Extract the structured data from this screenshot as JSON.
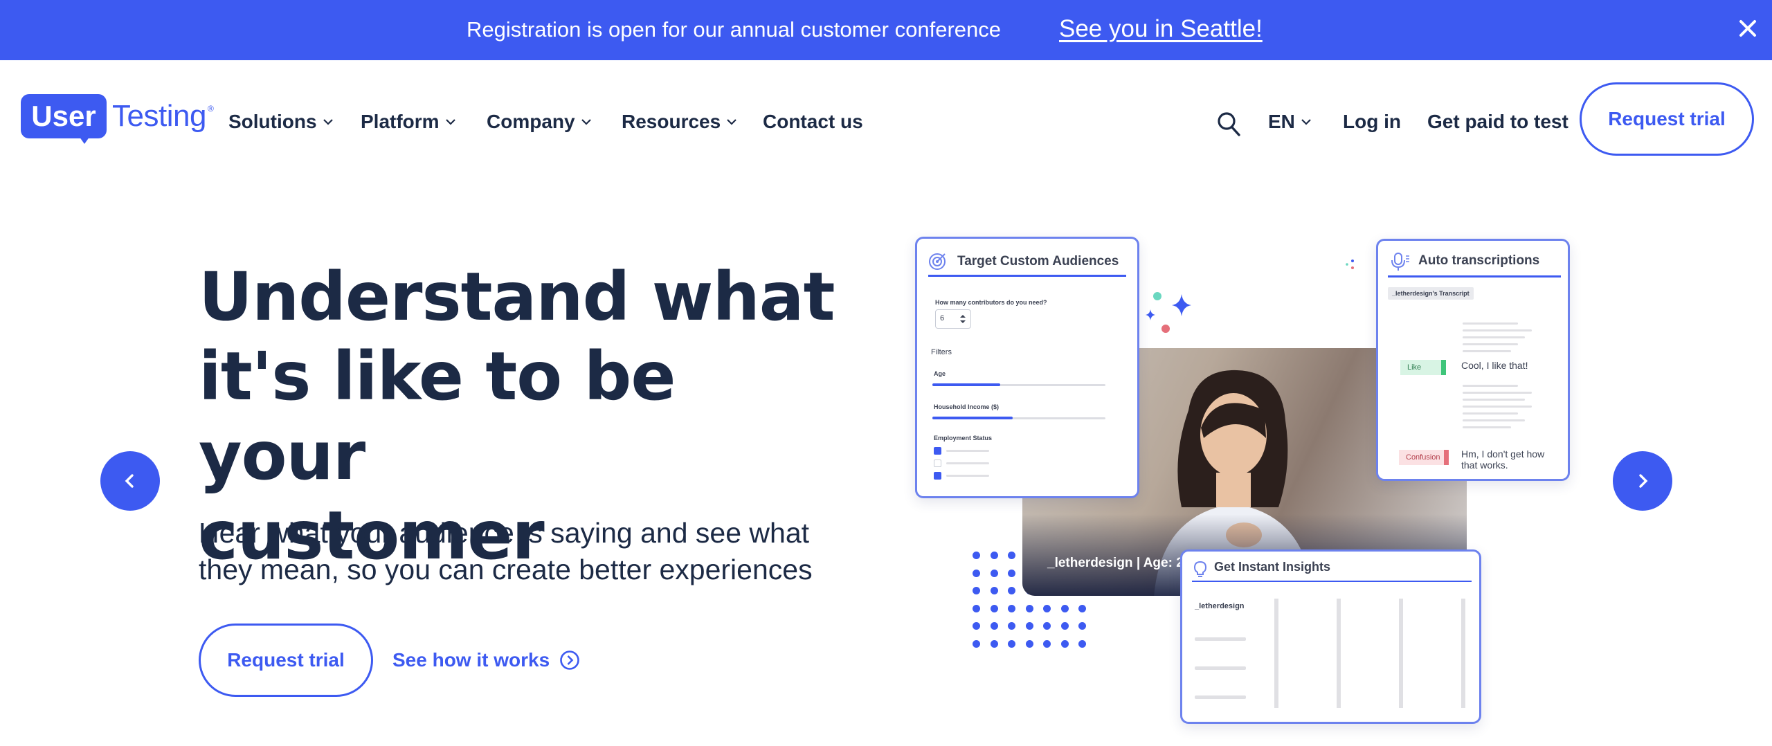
{
  "banner": {
    "text": "Registration is open for our annual customer conference",
    "link": "See you in Seattle!",
    "close_icon": "close-icon"
  },
  "header": {
    "logo_left": "User",
    "logo_right": "Testing",
    "nav": [
      {
        "label": "Solutions",
        "has_dropdown": true
      },
      {
        "label": "Platform",
        "has_dropdown": true
      },
      {
        "label": "Company",
        "has_dropdown": true
      },
      {
        "label": "Resources",
        "has_dropdown": true
      },
      {
        "label": "Contact us",
        "has_dropdown": false
      }
    ],
    "search_icon": "search-icon",
    "language": "EN",
    "login": "Log in",
    "get_paid": "Get paid to test",
    "cta": "Request trial"
  },
  "hero": {
    "title_lines": [
      "Understand what",
      "it's like to be your",
      "customer"
    ],
    "subtitle_lines": [
      "Hear what your audience is saying and see what",
      "they mean, so you can create better experiences"
    ],
    "cta": "Request trial",
    "secondary_link": "See how it works"
  },
  "illustration": {
    "audiences_card": {
      "title": "Target Custom Audiences",
      "question": "How many contributors do you need?",
      "count_value": "6",
      "filters_label": "Filters",
      "age_label": "Age",
      "income_label": "Household Income ($)",
      "employment_label": "Employment Status"
    },
    "photo_caption": "_letherdesign  |  Age: 2",
    "transcriptions_card": {
      "title": "Auto transcriptions",
      "transcript_label": "_letherdesign's Transcript",
      "tag_like": "Like",
      "quote_like": "Cool, I like that!",
      "tag_confusion": "Confusion",
      "quote_confusion": "Hm, I don't get how that works."
    },
    "insights_card": {
      "title": "Get Instant Insights",
      "row_label": "_letherdesign"
    }
  },
  "colors": {
    "brand_blue": "#3d5af1",
    "text_dark": "#1c2a45",
    "like_green": "#3fc57a",
    "confusion_red": "#e56f7a"
  }
}
